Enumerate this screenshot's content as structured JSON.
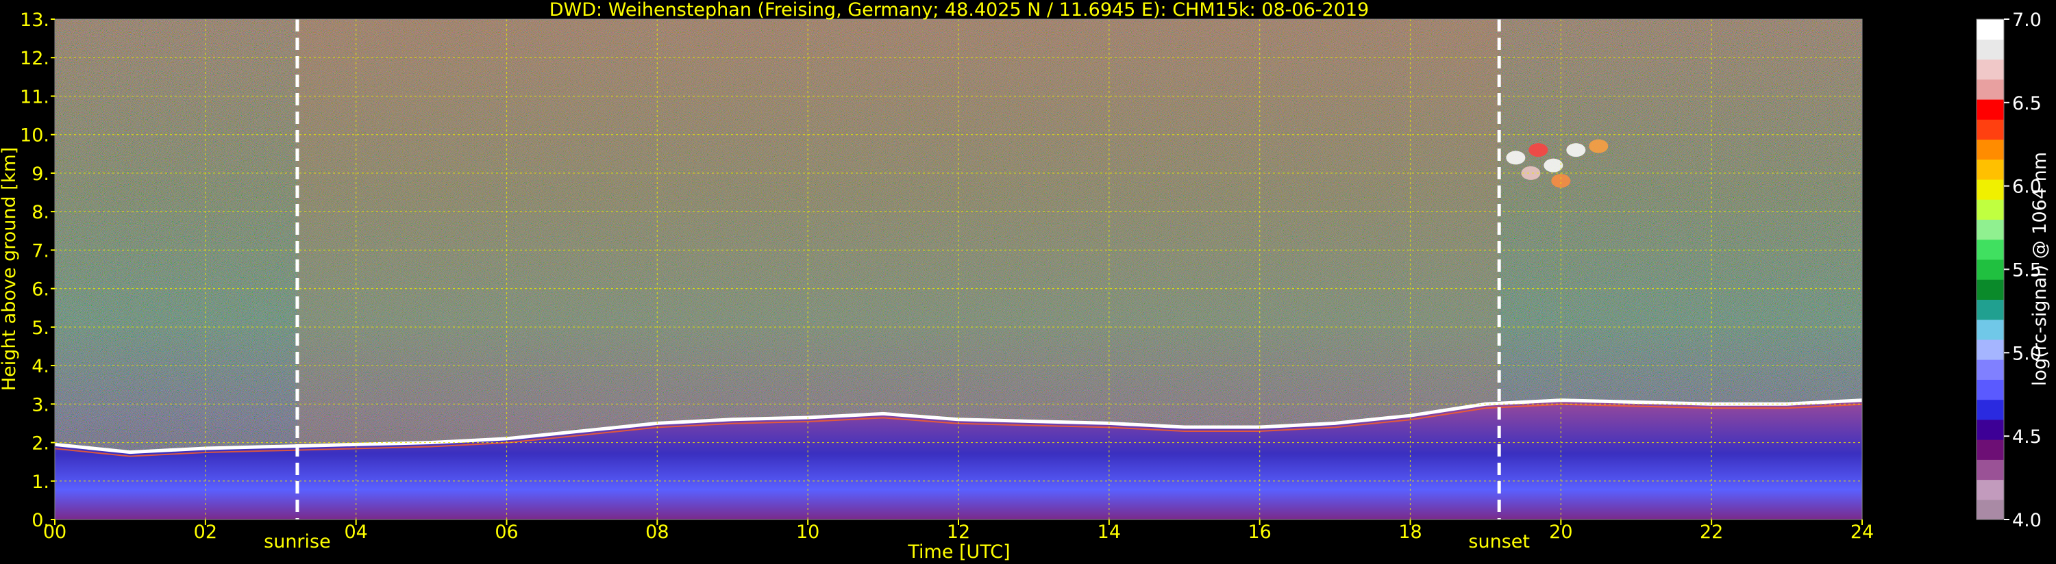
{
  "chart_data": {
    "type": "heatmap",
    "title": "DWD: Weihenstephan (Freising, Germany; 48.4025 N / 11.6945 E):    CHM15k: 08-06-2019",
    "xlabel": "Time [UTC]",
    "ylabel": "Height above ground [km]",
    "colorbar_label": "log(rc-signal) @ 1064 nm",
    "xlim": [
      0,
      24
    ],
    "ylim": [
      0,
      13
    ],
    "x_ticks": [
      "00",
      "02",
      "04",
      "06",
      "08",
      "10",
      "12",
      "14",
      "16",
      "18",
      "20",
      "22",
      "24"
    ],
    "y_ticks": [
      "0.",
      "1.",
      "2.",
      "3.",
      "4.",
      "5.",
      "6.",
      "7.",
      "8.",
      "9.",
      "10.",
      "11.",
      "12.",
      "13."
    ],
    "colorbar_range": [
      4.0,
      7.0
    ],
    "colorbar_ticks": [
      "4.0",
      "4.5",
      "5.0",
      "5.5",
      "6.0",
      "6.5",
      "7.0"
    ],
    "colorbar_colors": [
      "#a98aa5",
      "#c29bbd",
      "#9a5296",
      "#6d0f75",
      "#3d0096",
      "#2a2ae0",
      "#5a5aff",
      "#8080ff",
      "#a5b5ff",
      "#70c8e8",
      "#20a090",
      "#0a8a2a",
      "#20c040",
      "#40e060",
      "#90f090",
      "#c0ff40",
      "#f0f000",
      "#ffc000",
      "#ff8c00",
      "#ff4010",
      "#ff0000",
      "#e8a0a0",
      "#f0c8c8",
      "#e8e8e8",
      "#ffffff"
    ],
    "annotations": [
      {
        "label": "sunrise",
        "x": 3.22
      },
      {
        "label": "sunset",
        "x": 19.18
      }
    ],
    "boundary_layer_top": {
      "x": [
        0,
        1,
        2,
        3,
        4,
        5,
        6,
        7,
        8,
        9,
        10,
        11,
        12,
        13,
        14,
        15,
        16,
        17,
        18,
        19,
        20,
        21,
        22,
        23,
        24
      ],
      "y": [
        1.95,
        1.75,
        1.85,
        1.9,
        1.95,
        2.0,
        2.1,
        2.3,
        2.5,
        2.6,
        2.65,
        2.75,
        2.6,
        2.55,
        2.5,
        2.4,
        2.4,
        2.5,
        2.7,
        3.0,
        3.1,
        3.05,
        3.0,
        3.0,
        3.1
      ]
    },
    "grid": true,
    "colormap": "calipso-like",
    "background_color": "#000000",
    "axis_text_color": "#ffff00"
  }
}
